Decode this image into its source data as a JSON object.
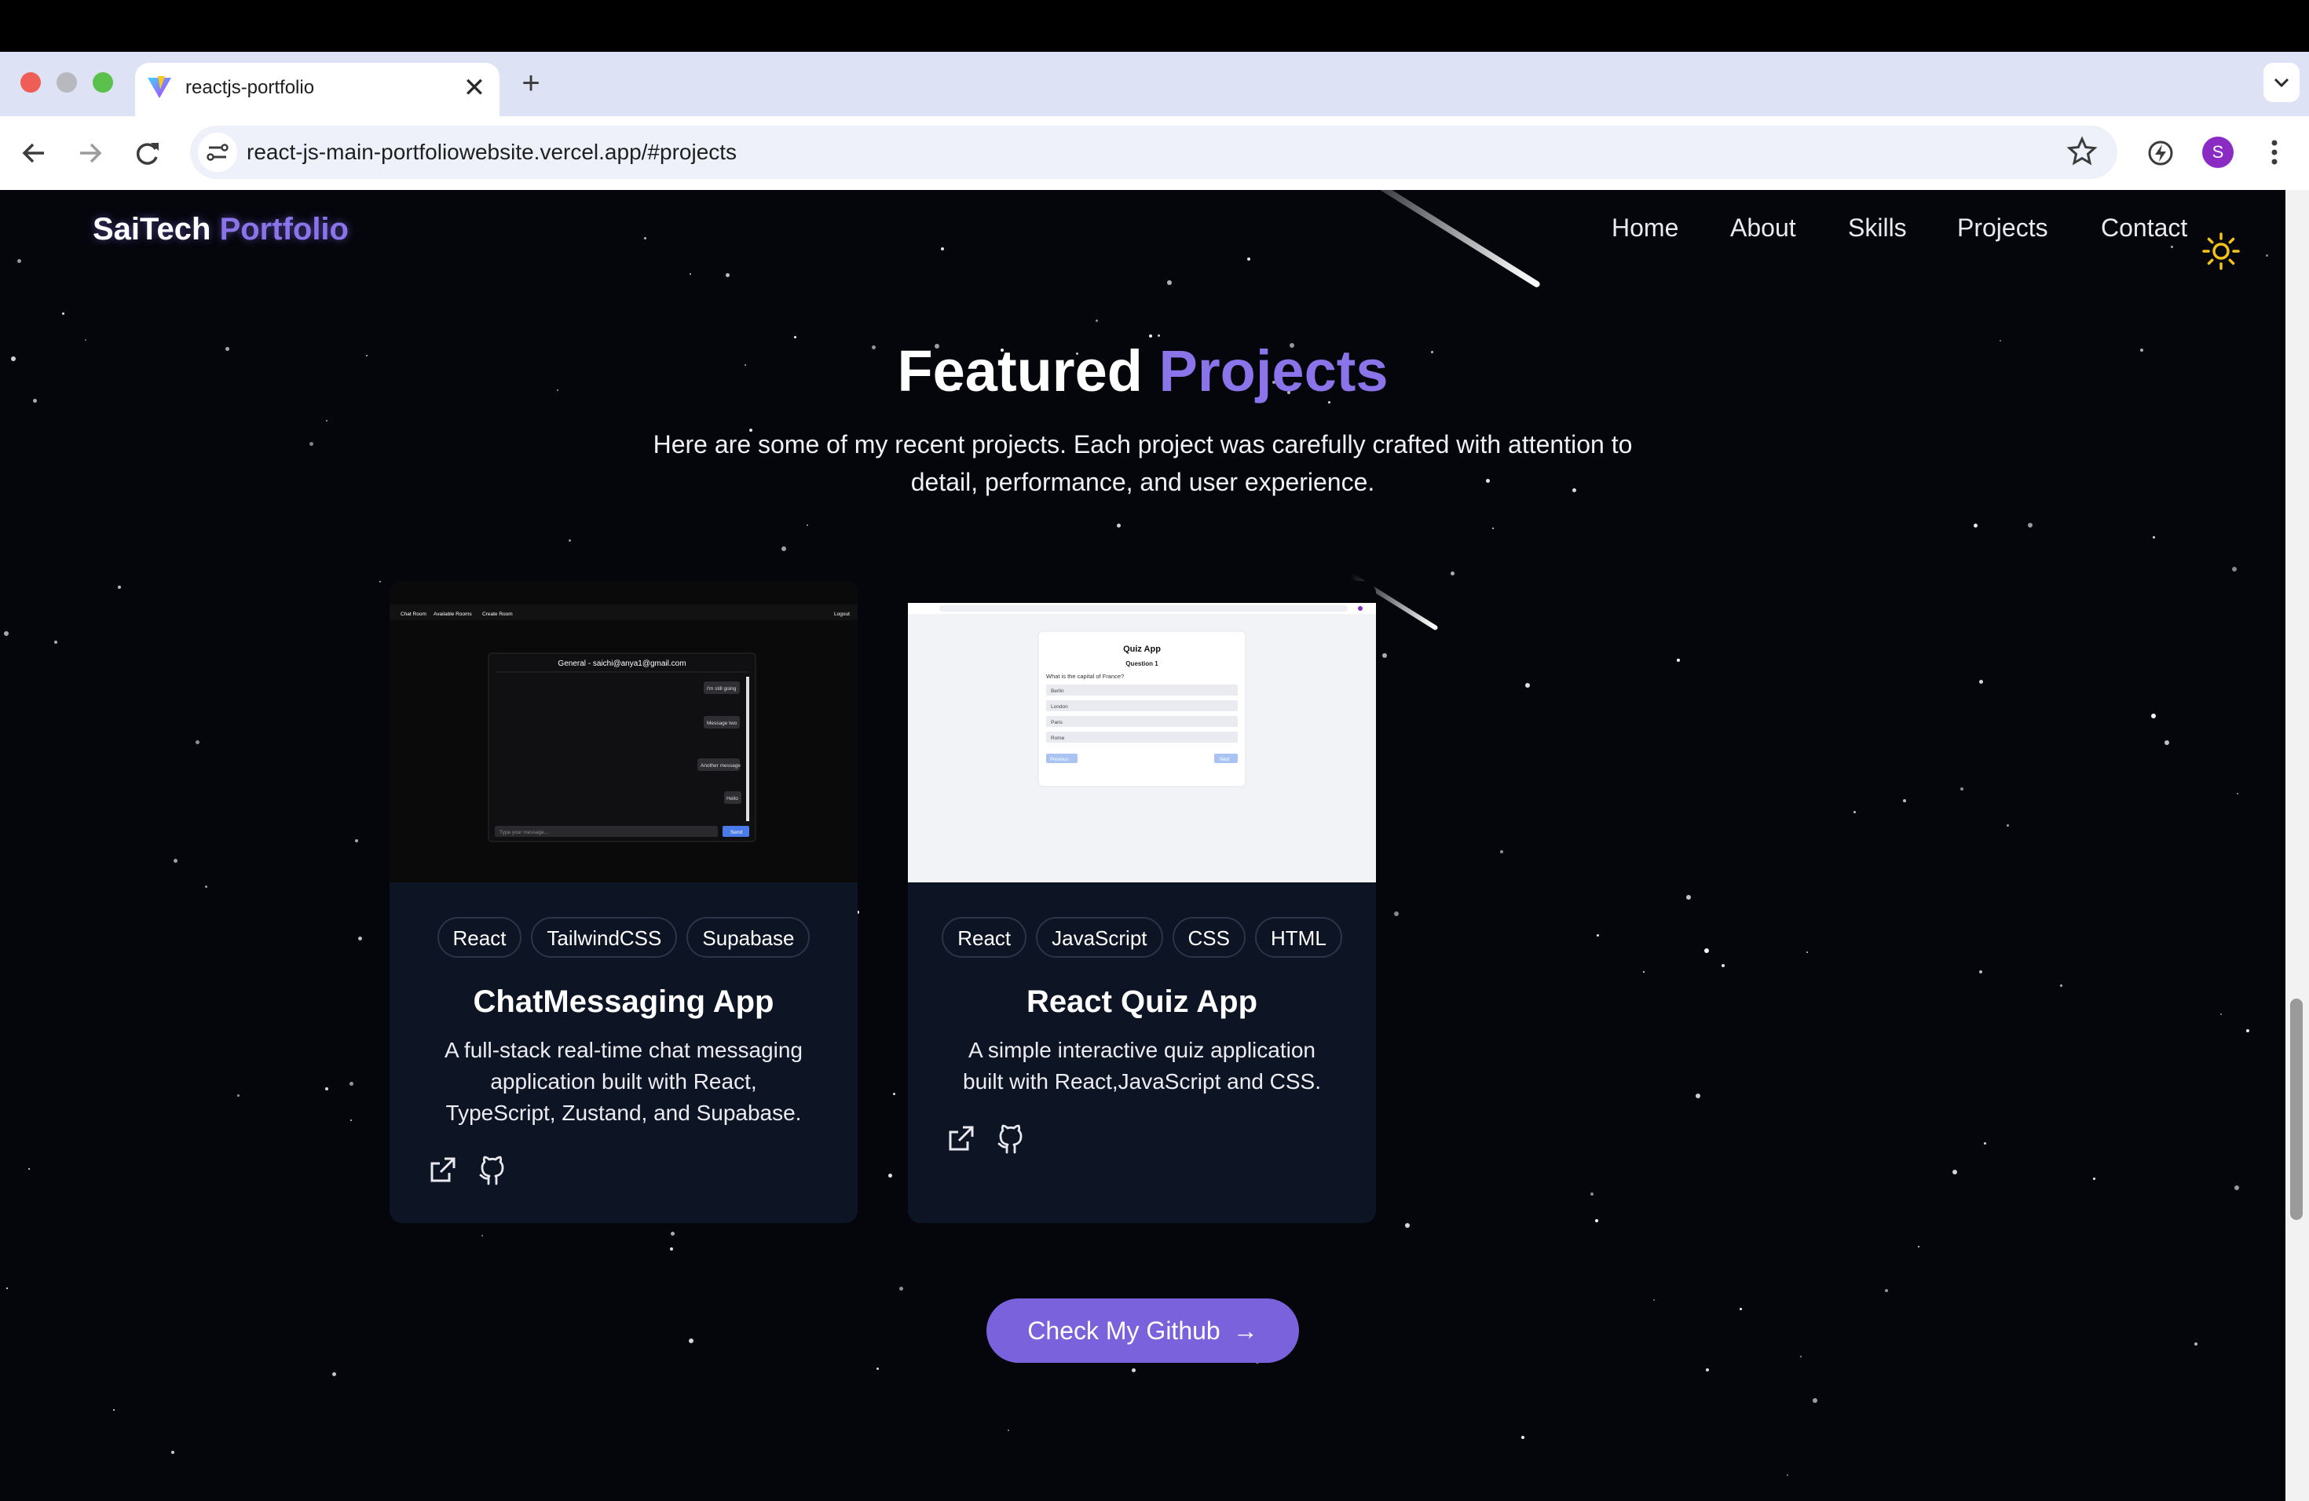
{
  "browser": {
    "tab_title": "reactjs-portfolio",
    "tab_close": "✕",
    "new_tab": "+",
    "url": "react-js-main-portfoliowebsite.vercel.app/#projects",
    "profile_initial": "S",
    "icons": [
      "back-arrow-icon",
      "forward-arrow-icon",
      "reload-icon",
      "site-info-icon",
      "bookmark-star-icon",
      "extension-icon",
      "more-menu-icon",
      "tab-search-icon"
    ]
  },
  "site": {
    "brand_primary": "SaiTech",
    "brand_accent": "Portfolio",
    "nav": [
      "Home",
      "About",
      "Skills",
      "Projects",
      "Contact"
    ],
    "theme_icon": "sun-icon",
    "accent_color": "#8b74ea"
  },
  "projects_section": {
    "heading_primary": "Featured",
    "heading_accent": "Projects",
    "intro_line1": "Here are some of my recent projects. Each project was carefully crafted with attention to",
    "intro_line2": "detail, performance, and user experience.",
    "cards": [
      {
        "title": "ChatMessaging App",
        "tags": [
          "React",
          "TailwindCSS",
          "Supabase"
        ],
        "desc_lines": [
          "A full-stack real-time chat messaging",
          "application built with React,",
          "TypeScript, Zustand, and Supabase."
        ],
        "screenshot": {
          "nav": [
            "Chat Room",
            "Available Rooms",
            "Create Room"
          ],
          "logout": "Logout",
          "chat_header": "General - saichi@anya1@gmail.com",
          "input_placeholder": "Type your message...",
          "send": "Send",
          "messages": [
            "I'm still going",
            "Message two",
            "Another message",
            "Hello"
          ]
        }
      },
      {
        "title": "React Quiz App",
        "tags": [
          "React",
          "JavaScript",
          "CSS",
          "HTML"
        ],
        "desc_lines": [
          "A simple interactive quiz application",
          "built with React,JavaScript and CSS."
        ],
        "screenshot": {
          "title": "Quiz App",
          "question_no": "Question 1",
          "question": "What is the capital of France?",
          "options": [
            "Berlin",
            "London",
            "Paris",
            "Rome"
          ],
          "prev": "Previous",
          "next": "Next"
        }
      }
    ],
    "github_button": "Check My Github",
    "github_arrow": "→"
  }
}
